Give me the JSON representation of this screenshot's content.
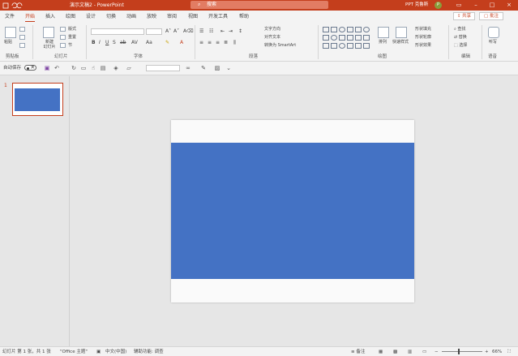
{
  "titlebar": {
    "title": "演示文稿2  -  PowerPoint",
    "search_placeholder": "搜索",
    "user": "PPT 克鲁斯",
    "colors": {
      "accent": "#c43e1c"
    }
  },
  "tabs": [
    {
      "label": "文件"
    },
    {
      "label": "开始"
    },
    {
      "label": "插入"
    },
    {
      "label": "绘图"
    },
    {
      "label": "设计"
    },
    {
      "label": "切换"
    },
    {
      "label": "动画"
    },
    {
      "label": "放映"
    },
    {
      "label": "审阅"
    },
    {
      "label": "视图"
    },
    {
      "label": "开发工具"
    },
    {
      "label": "帮助"
    }
  ],
  "share_label": "共享",
  "comment_label": "批注",
  "ribbon": {
    "paste": "粘贴",
    "new_slide": "新建\n幻灯片",
    "layout": "版式",
    "reset": "重置",
    "section": "节",
    "text_direction": "文字方向",
    "align_text": "对齐文本",
    "smartart": "转换为 SmartArt",
    "arrange": "排列",
    "quick_styles": "快速样式",
    "shape_fill": "形状填充",
    "shape_outline": "形状轮廓",
    "shape_effects": "形状效果",
    "find": "查找",
    "replace": "替换",
    "select": "选择",
    "dictate": "听写",
    "groups": [
      "剪贴板",
      "幻灯片",
      "字体",
      "段落",
      "绘图",
      "编辑",
      "语音"
    ]
  },
  "qbar": {
    "autosave": "自动保存",
    "toggle_state": "关"
  },
  "thumb_number": "1",
  "statusbar": {
    "slide_info": "幻灯片 第 1 张，共 1 张",
    "theme": "\"Office 主题\"",
    "language": "中文(中国)",
    "accessibility": "辅助功能: 调查",
    "notes": "备注",
    "zoom": "66%"
  },
  "slide": {
    "band_color": "#4472c4"
  }
}
